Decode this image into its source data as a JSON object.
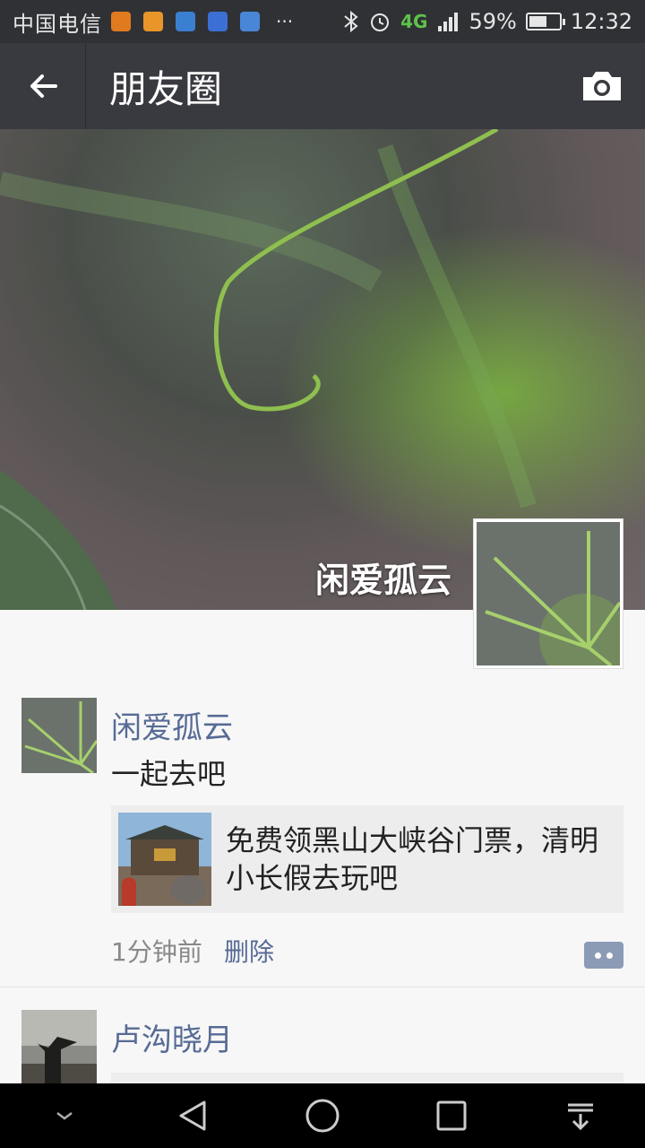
{
  "status_bar": {
    "carrier": "中国电信",
    "overflow": "···",
    "network": "4G",
    "battery": "59%",
    "time": "12:32",
    "battery_fraction": 0.59
  },
  "title_bar": {
    "title": "朋友圈"
  },
  "cover": {
    "user_name": "闲爱孤云"
  },
  "posts": [
    {
      "name": "闲爱孤云",
      "text": "一起去吧",
      "link_title": "免费领黑山大峡谷门票，清明小长假去玩吧",
      "time": "1分钟前",
      "delete": "删除"
    },
    {
      "name": "卢沟晓月"
    }
  ],
  "colors": {
    "accent_name": "#576b95",
    "title_bar": "#393a3f",
    "status_bar": "#2f3135"
  }
}
